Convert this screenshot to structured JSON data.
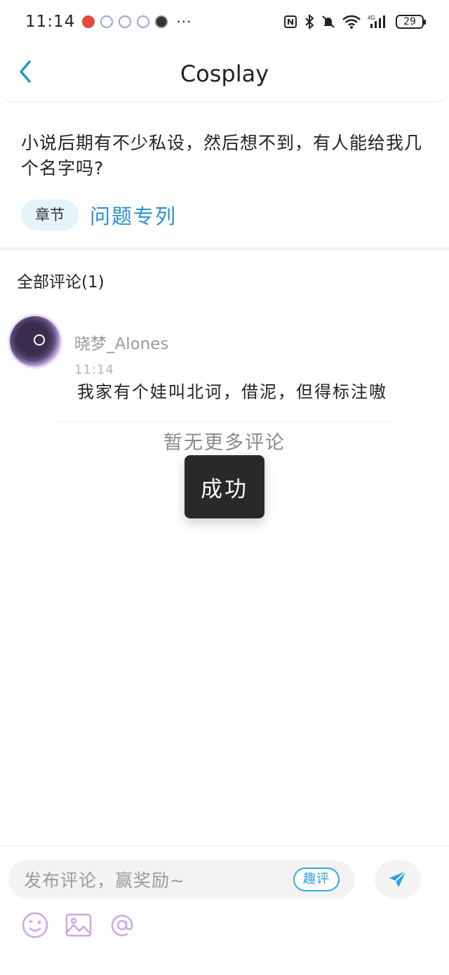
{
  "status_bar": {
    "time": "11:14",
    "more_indicator": "···",
    "battery_level": "29"
  },
  "header": {
    "title": "Cosplay"
  },
  "post": {
    "question": "小说后期有不少私设，然后想不到，有人能给我几个名字吗?",
    "tag": "章节",
    "link": "问题专列"
  },
  "comments": {
    "header": "全部评论(1)",
    "items": [
      {
        "username": "晓梦_Alones",
        "time": "11:14",
        "text": "我家有个娃叫北诃，借泥，但得标注嗷"
      }
    ],
    "no_more": "暂无更多评论"
  },
  "toast": {
    "message": "成功"
  },
  "composer": {
    "placeholder": "发布评论，赢奖励~",
    "badge": "趣评",
    "icons": [
      "emoji-icon",
      "image-icon",
      "at-icon",
      "send-icon"
    ]
  },
  "colors": {
    "accent": "#2a8fd0",
    "tag_bg": "#e5f4fb",
    "tool_icon": "#c9a8e8",
    "send_icon": "#2a9fe3"
  }
}
